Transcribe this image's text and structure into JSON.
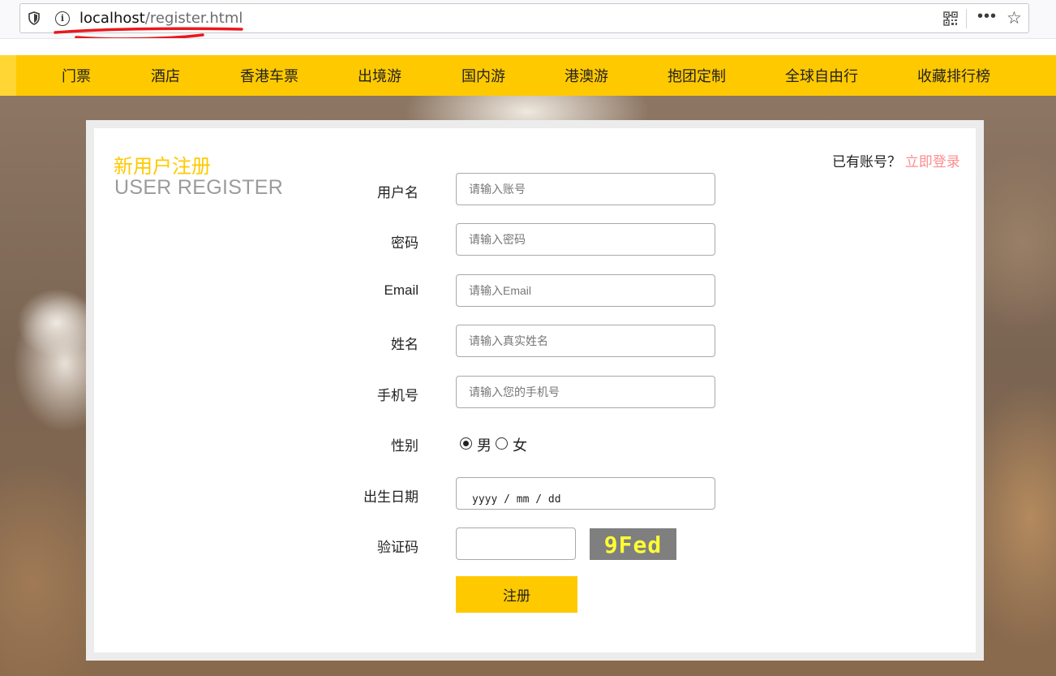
{
  "browser": {
    "url_host": "localhost",
    "url_path": "/register.html"
  },
  "nav": {
    "items": [
      "门票",
      "酒店",
      "香港车票",
      "出境游",
      "国内游",
      "港澳游",
      "抱团定制",
      "全球自由行",
      "收藏排行榜"
    ]
  },
  "register": {
    "title_cn": "新用户注册",
    "title_en": "USER REGISTER",
    "login_prompt": "已有账号？",
    "login_link": "立即登录",
    "fields": {
      "username": {
        "label": "用户名",
        "placeholder": "请输入账号"
      },
      "password": {
        "label": "密码",
        "placeholder": "请输入密码"
      },
      "email": {
        "label": "Email",
        "placeholder": "请输入Email"
      },
      "name": {
        "label": "姓名",
        "placeholder": "请输入真实姓名"
      },
      "phone": {
        "label": "手机号",
        "placeholder": "请输入您的手机号"
      }
    },
    "gender": {
      "label": "性别",
      "male": "男",
      "female": "女",
      "selected": "男"
    },
    "birthday": {
      "label": "出生日期",
      "placeholder": "yyyy / mm / dd"
    },
    "captcha": {
      "label": "验证码",
      "code": "9Fed"
    },
    "submit_label": "注册"
  },
  "colors": {
    "accent": "#ffc900",
    "login_link": "#ff8c8c",
    "captcha_bg": "#7f7f7f",
    "captcha_text": "#ffff33"
  }
}
